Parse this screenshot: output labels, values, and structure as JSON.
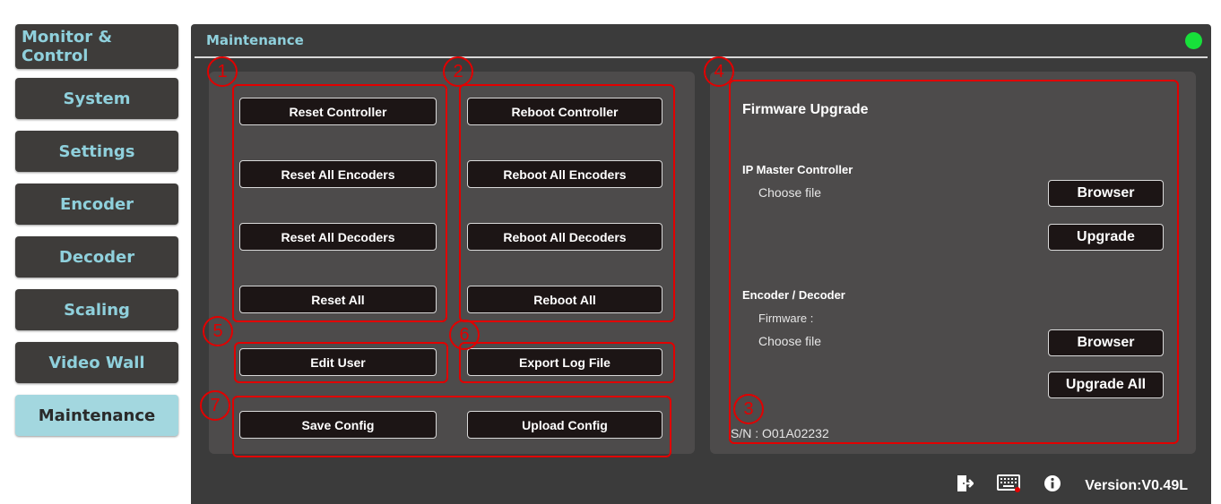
{
  "sidebar": {
    "items": [
      {
        "label": "Monitor & Control"
      },
      {
        "label": "System"
      },
      {
        "label": "Settings"
      },
      {
        "label": "Encoder"
      },
      {
        "label": "Decoder"
      },
      {
        "label": "Scaling"
      },
      {
        "label": "Video Wall"
      },
      {
        "label": "Maintenance",
        "active": true
      }
    ]
  },
  "header": {
    "title": "Maintenance",
    "status_color": "#17e03a"
  },
  "reset": {
    "controller": "Reset Controller",
    "encoders": "Reset All Encoders",
    "decoders": "Reset All Decoders",
    "all": "Reset All"
  },
  "reboot": {
    "controller": "Reboot Controller",
    "encoders": "Reboot All Encoders",
    "decoders": "Reboot All Decoders",
    "all": "Reboot All"
  },
  "user": {
    "edit": "Edit User"
  },
  "log": {
    "export": "Export Log File"
  },
  "config": {
    "save": "Save Config",
    "upload": "Upload Config"
  },
  "firmware": {
    "title": "Firmware Upgrade",
    "ipmc_label": "IP Master Controller",
    "ipmc_choose": "Choose file",
    "ipmc_browser": "Browser",
    "ipmc_upgrade": "Upgrade",
    "encdec_label": "Encoder / Decoder",
    "encdec_firmware": "Firmware :",
    "encdec_choose": "Choose file",
    "encdec_browser": "Browser",
    "encdec_upgrade_all": "Upgrade All",
    "serial": "S/N : O01A02232"
  },
  "annotations": [
    "1",
    "2",
    "3",
    "4",
    "5",
    "6",
    "7"
  ],
  "footer": {
    "icons": [
      "logout-icon",
      "keyboard-icon",
      "info-icon"
    ],
    "version": "Version:V0.49L"
  },
  "colors": {
    "accent": "#8fd0dc",
    "active_nav": "#a3d7df",
    "panel_bg": "#3b3b3b",
    "annotation": "#e10000"
  }
}
